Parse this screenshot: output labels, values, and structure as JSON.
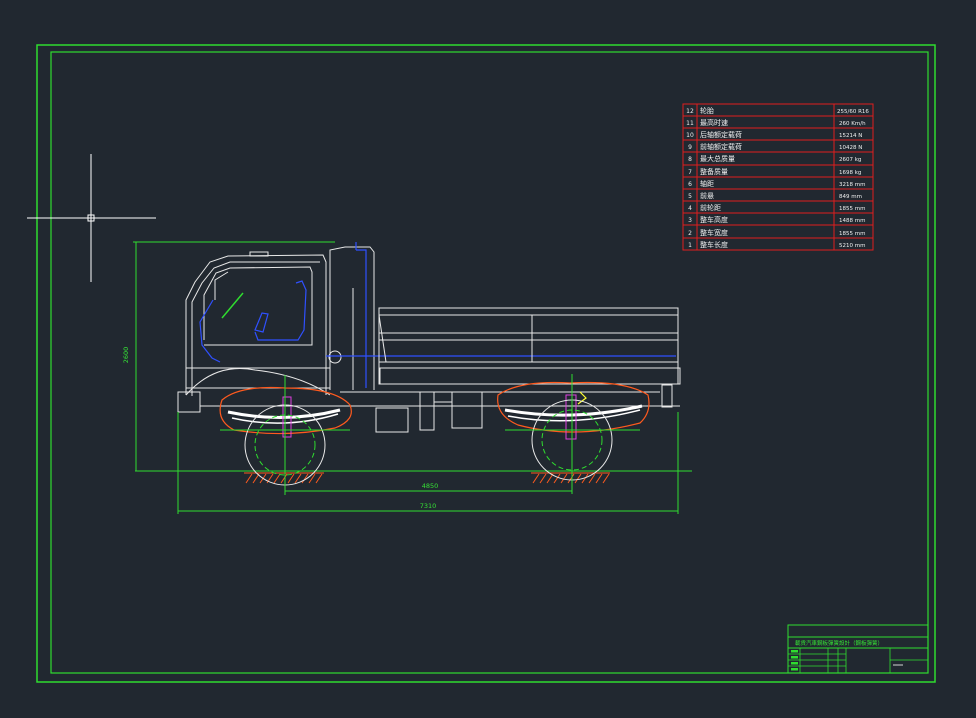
{
  "spec_table": {
    "rows": [
      {
        "no": "12",
        "name": "轮胎",
        "value": "255/60 R16"
      },
      {
        "no": "11",
        "name": "最高时速",
        "value": "260 Km/h"
      },
      {
        "no": "10",
        "name": "后轴额定载荷",
        "value": "15214 N"
      },
      {
        "no": "9",
        "name": "前轴额定载荷",
        "value": "10428 N"
      },
      {
        "no": "8",
        "name": "最大总质量",
        "value": "2607 kg"
      },
      {
        "no": "7",
        "name": "整备质量",
        "value": "1698 kg"
      },
      {
        "no": "6",
        "name": "轴距",
        "value": "3218 mm"
      },
      {
        "no": "5",
        "name": "前悬",
        "value": "849 mm"
      },
      {
        "no": "4",
        "name": "前轮距",
        "value": "1855 mm"
      },
      {
        "no": "3",
        "name": "整车高度",
        "value": "1488 mm"
      },
      {
        "no": "2",
        "name": "整车宽度",
        "value": "1855 mm"
      },
      {
        "no": "1",
        "name": "整车长度",
        "value": "5210 mm"
      }
    ]
  },
  "dimensions": {
    "height": "2600",
    "wheelbase": "4850",
    "overall_length": "7310"
  },
  "title_block": {
    "title": "載貨汽車鋼板彈簧設計（鋼板彈簧）"
  },
  "colors": {
    "background": "#212830",
    "frame": "#2fdc2f",
    "table_border": "#e01e1e",
    "outline": "#e8e8e8",
    "blue": "#2f50ff",
    "orange": "#ff5a1e",
    "magenta": "#e040e0",
    "yellow": "#ffff30"
  }
}
